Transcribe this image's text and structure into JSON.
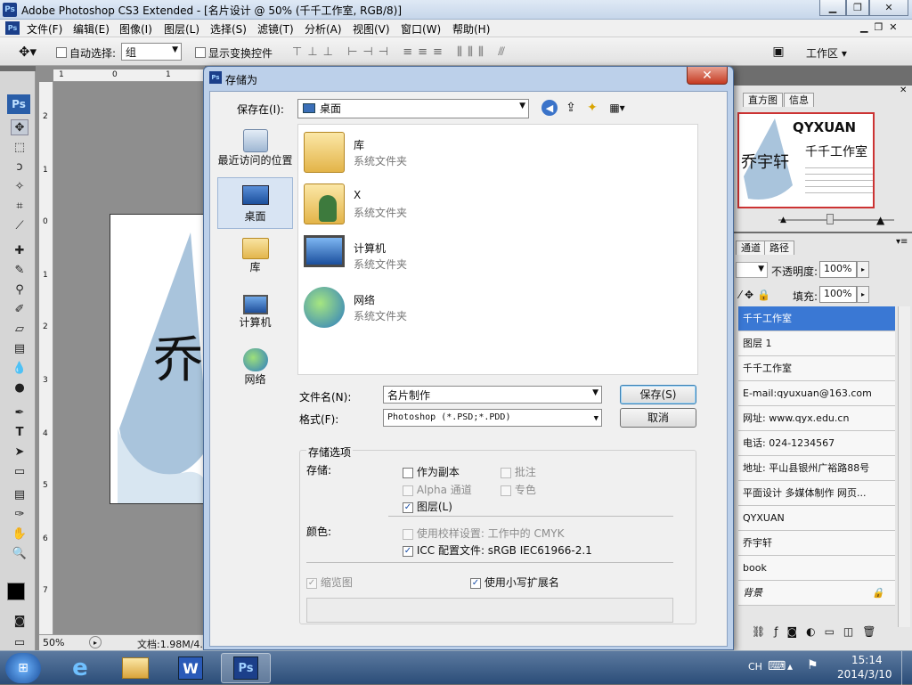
{
  "app": {
    "title": "Adobe Photoshop CS3 Extended - [名片设计 @ 50% (千千工作室, RGB/8)]",
    "ps_logo": "Ps"
  },
  "menu": [
    "文件(F)",
    "编辑(E)",
    "图像(I)",
    "图层(L)",
    "选择(S)",
    "滤镜(T)",
    "分析(A)",
    "视图(V)",
    "窗口(W)",
    "帮助(H)"
  ],
  "options_bar": {
    "auto_select_label": "自动选择:",
    "auto_select_value": "组",
    "show_transform_label": "显示变换控件",
    "workspace_label": "工作区 ▾"
  },
  "document": {
    "zoom": "50%",
    "doc_info": "文档:1.98M/4.",
    "canvas_text": "乔",
    "ruler_top": [
      "1",
      "0",
      "1"
    ],
    "ruler_left": [
      "2",
      "1",
      "0",
      "1",
      "2",
      "3",
      "4",
      "5",
      "6",
      "7"
    ]
  },
  "navigator": {
    "tabs": [
      "直方图",
      "信息"
    ],
    "preview_title": "QYXUAN",
    "preview_sub": "千千工作室",
    "preview_name": "乔宇轩"
  },
  "layers_panel": {
    "tabs": [
      "通道",
      "路径"
    ],
    "opacity_label": "不透明度:",
    "opacity_value": "100%",
    "fill_label": "填充:",
    "fill_value": "100%",
    "layers": [
      "千千工作室",
      "图层 1",
      "千千工作室",
      "E-mail:qyuxuan@163.com",
      "网址: www.qyx.edu.cn",
      "电话: 024-1234567",
      "地址: 平山县银州广裕路88号",
      "平面设计 多媒体制作 网页...",
      "QYXUAN",
      "乔宇轩",
      "book",
      "背景"
    ]
  },
  "dialog": {
    "title": "存储为",
    "save_in_label": "保存在(I):",
    "save_in_value": "桌面",
    "places": [
      "最近访问的位置",
      "桌面",
      "库",
      "计算机",
      "网络"
    ],
    "files": [
      {
        "name": "库",
        "type": "系统文件夹",
        "icon": "library-folder-icon"
      },
      {
        "name": "X",
        "type": "系统文件夹",
        "icon": "user-folder-icon"
      },
      {
        "name": "计算机",
        "type": "系统文件夹",
        "icon": "computer-icon"
      },
      {
        "name": "网络",
        "type": "系统文件夹",
        "icon": "network-icon"
      }
    ],
    "filename_label": "文件名(N):",
    "filename_value": "名片制作",
    "format_label": "格式(F):",
    "format_value": "Photoshop (*.PSD;*.PDD)",
    "save_button": "保存(S)",
    "cancel_button": "取消",
    "options_group": "存储选项",
    "save_label": "存储:",
    "opt_copy": "作为副本",
    "opt_notes": "批注",
    "opt_alpha": "Alpha 通道",
    "opt_spot": "专色",
    "opt_layers": "图层(L)",
    "color_label": "颜色:",
    "opt_proof": "使用校样设置: 工作中的 CMYK",
    "opt_icc": "ICC 配置文件: sRGB IEC61966-2.1",
    "opt_thumb": "缩览图",
    "opt_lowercase": "使用小写扩展名"
  },
  "taskbar": {
    "lang": "CH",
    "time": "15:14",
    "date": "2014/3/10"
  }
}
